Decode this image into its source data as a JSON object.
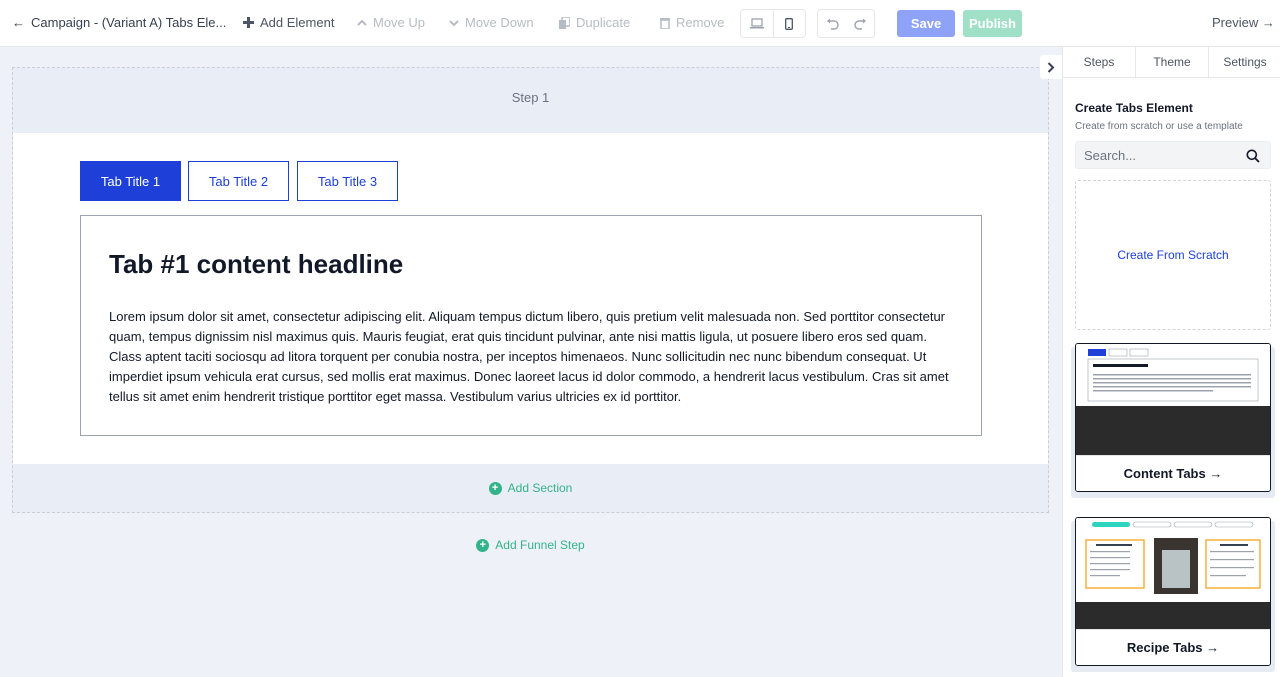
{
  "topbar": {
    "back_label": "Campaign - (Variant A) Tabs Ele...",
    "add_element": "Add Element",
    "move_up": "Move Up",
    "move_down": "Move Down",
    "duplicate": "Duplicate",
    "remove": "Remove",
    "save": "Save",
    "publish": "Publish",
    "preview": "Preview →"
  },
  "canvas": {
    "step_title": "Step 1",
    "tabs": [
      {
        "label": "Tab Title 1"
      },
      {
        "label": "Tab Title 2"
      },
      {
        "label": "Tab Title 3"
      }
    ],
    "headline": "Tab #1 content headline",
    "body": "Lorem ipsum dolor sit amet, consectetur adipiscing elit. Aliquam tempus dictum libero, quis pretium velit malesuada non. Sed porttitor consectetur quam, tempus dignissim nisl maximus quis. Mauris feugiat, erat quis tincidunt pulvinar, ante nisi mattis ligula, ut posuere libero eros sed quam. Class aptent taciti sociosqu ad litora torquent per conubia nostra, per inceptos himenaeos. Nunc sollicitudin nec nunc bibendum consequat. Ut imperdiet ipsum vehicula erat cursus, sed mollis erat maximus. Donec laoreet lacus id dolor commodo, a hendrerit lacus vestibulum. Cras sit amet tellus sit amet enim hendrerit tristique porttitor eget massa. Vestibulum varius ultricies ex id porttitor.",
    "add_section": "Add Section",
    "add_funnel_step": "Add Funnel Step"
  },
  "sidebar": {
    "tabs": [
      "Steps",
      "Theme",
      "Settings"
    ],
    "title": "Create Tabs Element",
    "subtitle": "Create from scratch or use a template",
    "search_placeholder": "Search...",
    "scratch_label": "Create From Scratch",
    "templates": [
      {
        "label": "Content Tabs →"
      },
      {
        "label": "Recipe Tabs →"
      }
    ]
  },
  "colors": {
    "brand_blue": "#1e40d8",
    "save": "#8ea2f8",
    "publish": "#9fe0c6",
    "accent_green": "#34b38a"
  }
}
